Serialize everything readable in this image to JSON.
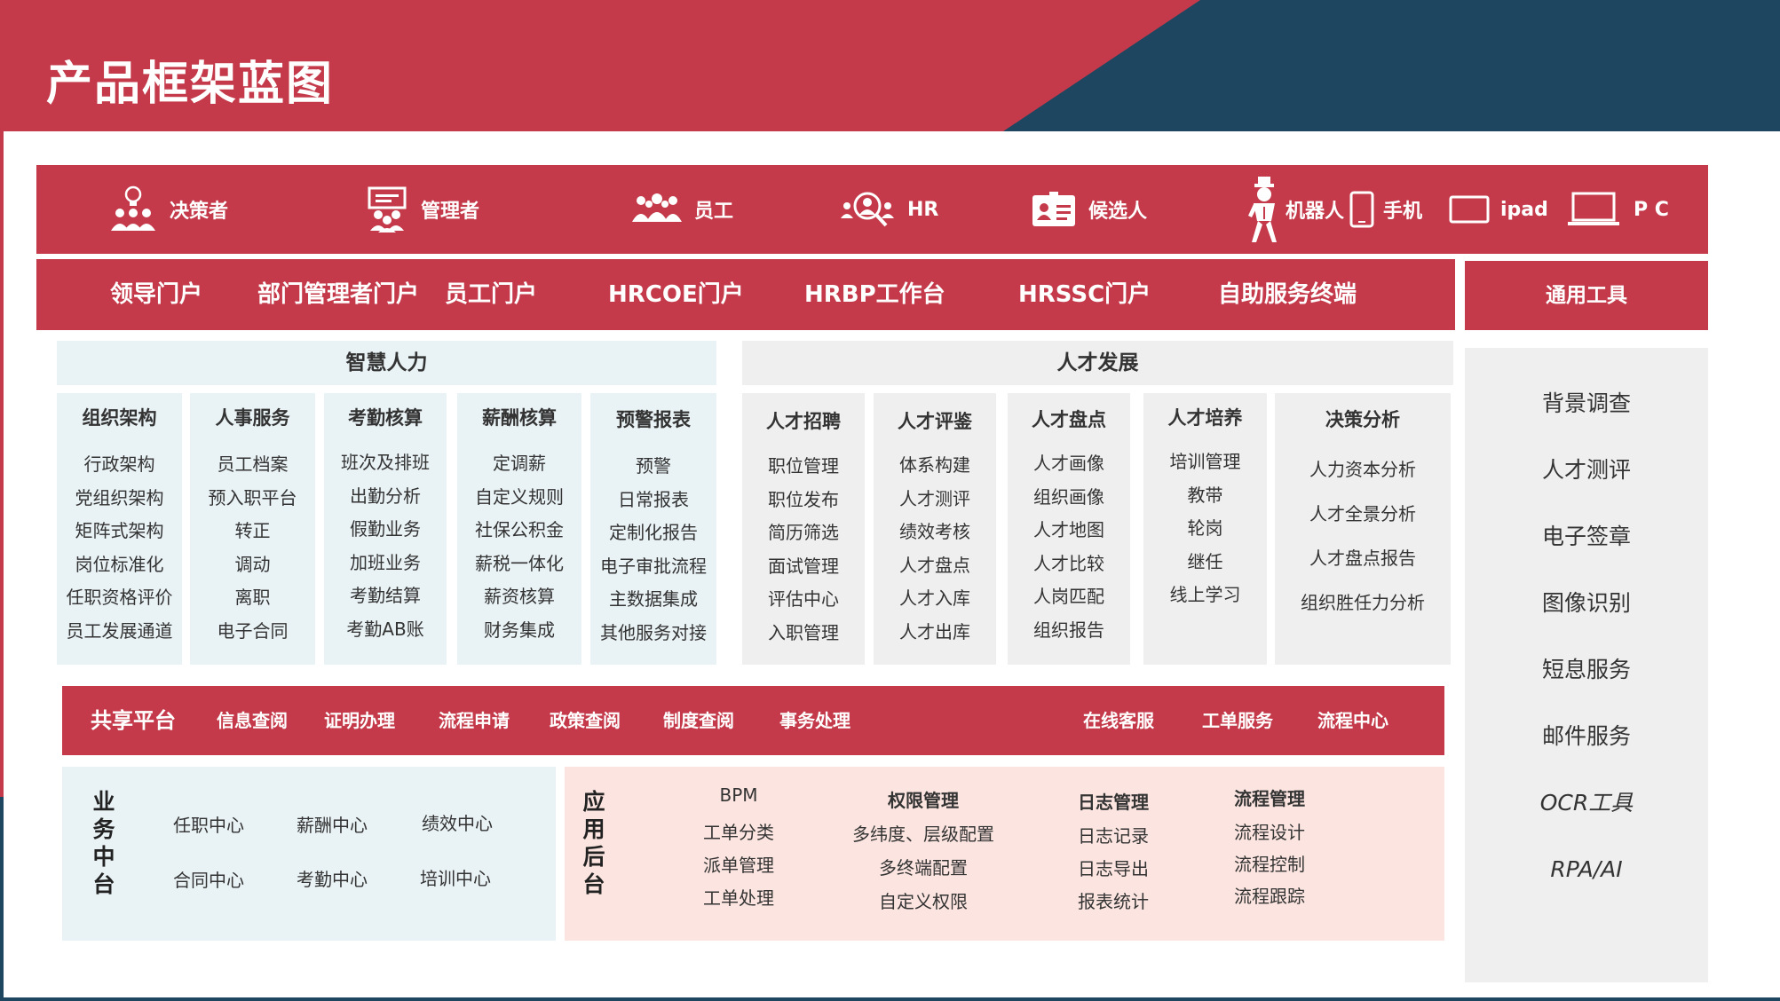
{
  "page": {
    "title": "产品框架蓝图"
  },
  "colors": {
    "red": "#c43a4a",
    "navy": "#1e4660",
    "light_blue": "#e9f2f5",
    "light_gray": "#efefef",
    "light_pink": "#fce5e0"
  },
  "roles": [
    {
      "label": "决策者",
      "icon": "lightbulb-people-icon"
    },
    {
      "label": "管理者",
      "icon": "presentation-board-icon"
    },
    {
      "label": "员工",
      "icon": "group-icon"
    },
    {
      "label": "HR",
      "icon": "hr-search-icon"
    },
    {
      "label": "候选人",
      "icon": "id-card-icon"
    },
    {
      "label": "机器人",
      "icon": "robot-icon"
    },
    {
      "label": "手机",
      "icon": "mobile-phone-icon"
    },
    {
      "label": "ipad",
      "icon": "tablet-icon"
    },
    {
      "label": "P C",
      "icon": "laptop-icon"
    }
  ],
  "portals": [
    "领导门户",
    "部门管理者门户",
    "员工门户",
    "HRCOE门户",
    "HRBP工作台",
    "HRSSC门户",
    "自助服务终端"
  ],
  "tools": {
    "title": "通用工具",
    "items": [
      "背景调查",
      "人才测评",
      "电子签章",
      "图像识别",
      "短息服务",
      "邮件服务",
      "OCR工具",
      "RPA/AI"
    ]
  },
  "smart_hr": {
    "title": "智慧人力",
    "columns": [
      {
        "title": "组织架构",
        "items": [
          "行政架构",
          "党组织架构",
          "矩阵式架构",
          "岗位标准化",
          "任职资格评价",
          "员工发展通道"
        ]
      },
      {
        "title": "人事服务",
        "items": [
          "员工档案",
          "预入职平台",
          "转正",
          "调动",
          "离职",
          "电子合同"
        ]
      },
      {
        "title": "考勤核算",
        "items": [
          "班次及排班",
          "出勤分析",
          "假勤业务",
          "加班业务",
          "考勤结算",
          "考勤AB账"
        ]
      },
      {
        "title": "薪酬核算",
        "items": [
          "定调薪",
          "自定义规则",
          "社保公积金",
          "薪税一体化",
          "薪资核算",
          "财务集成"
        ]
      },
      {
        "title": "预警报表",
        "items": [
          "预警",
          "日常报表",
          "定制化报告",
          "电子审批流程",
          "主数据集成",
          "其他服务对接"
        ]
      }
    ]
  },
  "talent_dev": {
    "title": "人才发展",
    "columns": [
      {
        "title": "人才招聘",
        "items": [
          "职位管理",
          "职位发布",
          "简历筛选",
          "面试管理",
          "评估中心",
          "入职管理"
        ]
      },
      {
        "title": "人才评鉴",
        "items": [
          "体系构建",
          "人才测评",
          "绩效考核",
          "人才盘点",
          "人才入库",
          "人才出库"
        ]
      },
      {
        "title": "人才盘点",
        "items": [
          "人才画像",
          "组织画像",
          "人才地图",
          "人才比较",
          "人岗匹配",
          "组织报告"
        ]
      },
      {
        "title": "人才培养",
        "items": [
          "培训管理",
          "教带",
          "轮岗",
          "继任",
          "线上学习"
        ]
      },
      {
        "title": "决策分析",
        "items": [
          "人力资本分析",
          "人才全景分析",
          "人才盘点报告",
          "组织胜任力分析"
        ]
      }
    ]
  },
  "shared_platform": {
    "title": "共享平台",
    "items": [
      "信息查阅",
      "证明办理",
      "流程申请",
      "政策查阅",
      "制度查阅",
      "事务处理",
      "在线客服",
      "工单服务",
      "流程中心"
    ]
  },
  "business_center": {
    "title": "业务中台",
    "items": [
      "任职中心",
      "薪酬中心",
      "绩效中心",
      "合同中心",
      "考勤中心",
      "培训中心"
    ]
  },
  "app_backend": {
    "title": "应用后台",
    "columns": [
      {
        "title": "BPM",
        "items": [
          "工单分类",
          "派单管理",
          "工单处理"
        ]
      },
      {
        "title": "权限管理",
        "items": [
          "多纬度、层级配置",
          "多终端配置",
          "自定义权限"
        ]
      },
      {
        "title": "日志管理",
        "items": [
          "日志记录",
          "日志导出",
          "报表统计"
        ]
      },
      {
        "title": "流程管理",
        "items": [
          "流程设计",
          "流程控制",
          "流程跟踪"
        ]
      }
    ]
  }
}
